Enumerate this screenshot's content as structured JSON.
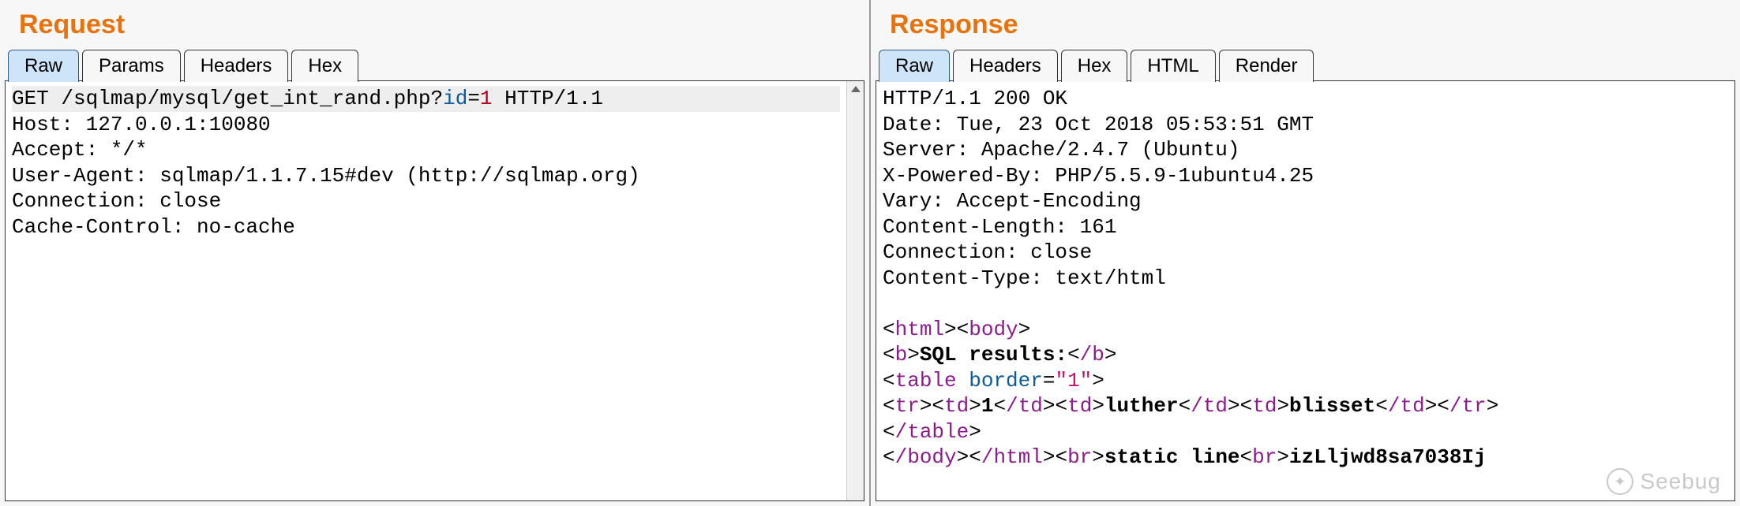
{
  "request": {
    "title": "Request",
    "tabs": [
      {
        "label": "Raw",
        "active": true
      },
      {
        "label": "Params",
        "active": false
      },
      {
        "label": "Headers",
        "active": false
      },
      {
        "label": "Hex",
        "active": false
      }
    ],
    "method": "GET",
    "path": "/sqlmap/mysql/get_int_rand.php",
    "query_param": "id",
    "query_value": "1",
    "http_version": "HTTP/1.1",
    "headers": [
      "Host: 127.0.0.1:10080",
      "Accept: */*",
      "User-Agent: sqlmap/1.1.7.15#dev (http://sqlmap.org)",
      "Connection: close",
      "Cache-Control: no-cache"
    ]
  },
  "response": {
    "title": "Response",
    "tabs": [
      {
        "label": "Raw",
        "active": true
      },
      {
        "label": "Headers",
        "active": false
      },
      {
        "label": "Hex",
        "active": false
      },
      {
        "label": "HTML",
        "active": false
      },
      {
        "label": "Render",
        "active": false
      }
    ],
    "status_line": "HTTP/1.1 200 OK",
    "headers": [
      "Date: Tue, 23 Oct 2018 05:53:51 GMT",
      "Server: Apache/2.4.7 (Ubuntu)",
      "X-Powered-By: PHP/5.5.9-1ubuntu4.25",
      "Vary: Accept-Encoding",
      "Content-Length: 161",
      "Connection: close",
      "Content-Type: text/html"
    ],
    "body_segments": [
      {
        "type": "tag",
        "text": "<html>"
      },
      {
        "type": "tag",
        "text": "<body>"
      },
      {
        "type": "nl"
      },
      {
        "type": "tag",
        "text": "<b>"
      },
      {
        "type": "bold",
        "text": "SQL results:"
      },
      {
        "type": "tag",
        "text": "</b>"
      },
      {
        "type": "nl"
      },
      {
        "type": "tag-open",
        "name": "table",
        "attr": "border",
        "val": "\"1\""
      },
      {
        "type": "nl"
      },
      {
        "type": "tag",
        "text": "<tr>"
      },
      {
        "type": "tag",
        "text": "<td>"
      },
      {
        "type": "bold",
        "text": "1"
      },
      {
        "type": "tag",
        "text": "</td>"
      },
      {
        "type": "tag",
        "text": "<td>"
      },
      {
        "type": "bold",
        "text": "luther"
      },
      {
        "type": "tag",
        "text": "</td>"
      },
      {
        "type": "tag",
        "text": "<td>"
      },
      {
        "type": "bold",
        "text": "blisset"
      },
      {
        "type": "tag",
        "text": "</td>"
      },
      {
        "type": "tag",
        "text": "</tr>"
      },
      {
        "type": "nl"
      },
      {
        "type": "tag",
        "text": "</table>"
      },
      {
        "type": "nl"
      },
      {
        "type": "tag",
        "text": "</body>"
      },
      {
        "type": "tag",
        "text": "</html>"
      },
      {
        "type": "tag",
        "text": "<br>"
      },
      {
        "type": "bold",
        "text": "static line"
      },
      {
        "type": "tag",
        "text": "<br>"
      },
      {
        "type": "bold",
        "text": "izLljwd8sa7038Ij"
      }
    ]
  },
  "watermark": "Seebug"
}
